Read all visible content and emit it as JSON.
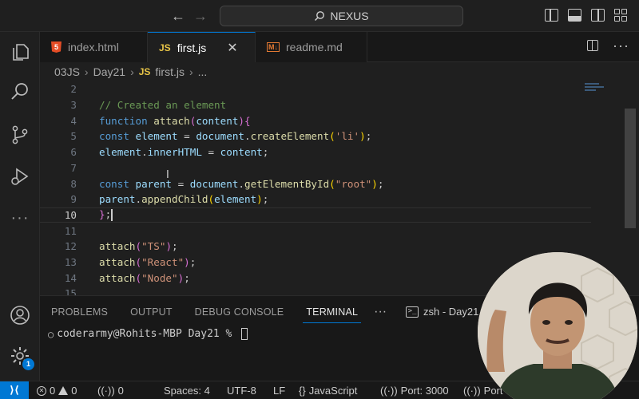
{
  "titlebar": {
    "back_arrow": "←",
    "forward_arrow": "→",
    "search_text": "NEXUS"
  },
  "tabs": [
    {
      "label": "index.html",
      "icon": "html-file-icon",
      "active": false
    },
    {
      "label": "first.js",
      "icon": "js-file-icon",
      "active": true
    },
    {
      "label": "readme.md",
      "icon": "markdown-file-icon",
      "active": false
    }
  ],
  "tab_icons": {
    "html": "5",
    "js": "JS",
    "md": "M↓"
  },
  "tab_close": "✕",
  "tab_more": "···",
  "breadcrumb": {
    "folder1": "03JS",
    "folder2": "Day21",
    "file_icon": "JS",
    "file": "first.js",
    "tail": "...",
    "sep": "›"
  },
  "editor": {
    "lines": [
      {
        "num": "2"
      },
      {
        "num": "3",
        "tokens": [
          [
            "comment",
            "// Created an element"
          ]
        ]
      },
      {
        "num": "4",
        "tokens": [
          [
            "kw",
            "function "
          ],
          [
            "fn",
            "attach"
          ],
          [
            "br1",
            "("
          ],
          [
            "var",
            "content"
          ],
          [
            "br1",
            ")"
          ],
          [
            "br1",
            "{"
          ]
        ]
      },
      {
        "num": "5",
        "tokens": [
          [
            "kw",
            "const "
          ],
          [
            "var",
            "element"
          ],
          [
            "punc",
            " = "
          ],
          [
            "var",
            "document"
          ],
          [
            "punc",
            "."
          ],
          [
            "fn",
            "createElement"
          ],
          [
            "br2",
            "("
          ],
          [
            "str",
            "'li'"
          ],
          [
            "br2",
            ")"
          ],
          [
            "punc",
            ";"
          ]
        ]
      },
      {
        "num": "6",
        "tokens": [
          [
            "var",
            "element"
          ],
          [
            "punc",
            "."
          ],
          [
            "var",
            "innerHTML"
          ],
          [
            "punc",
            " = "
          ],
          [
            "var",
            "content"
          ],
          [
            "punc",
            ";"
          ]
        ]
      },
      {
        "num": "7"
      },
      {
        "num": "8",
        "tokens": [
          [
            "kw",
            "const "
          ],
          [
            "var",
            "parent"
          ],
          [
            "punc",
            " = "
          ],
          [
            "var",
            "document"
          ],
          [
            "punc",
            "."
          ],
          [
            "fn",
            "getElementById"
          ],
          [
            "br2",
            "("
          ],
          [
            "str",
            "\"root\""
          ],
          [
            "br2",
            ")"
          ],
          [
            "punc",
            ";"
          ]
        ]
      },
      {
        "num": "9",
        "tokens": [
          [
            "var",
            "parent"
          ],
          [
            "punc",
            "."
          ],
          [
            "fn",
            "appendChild"
          ],
          [
            "br2",
            "("
          ],
          [
            "var",
            "element"
          ],
          [
            "br2",
            ")"
          ],
          [
            "punc",
            ";"
          ]
        ]
      },
      {
        "num": "10",
        "current": true,
        "tokens": [
          [
            "br1",
            "}"
          ],
          [
            "punc",
            ";"
          ]
        ]
      },
      {
        "num": "11"
      },
      {
        "num": "12",
        "tokens": [
          [
            "fn",
            "attach"
          ],
          [
            "br1",
            "("
          ],
          [
            "str",
            "\"TS\""
          ],
          [
            "br1",
            ")"
          ],
          [
            "punc",
            ";"
          ]
        ]
      },
      {
        "num": "13",
        "tokens": [
          [
            "fn",
            "attach"
          ],
          [
            "br1",
            "("
          ],
          [
            "str",
            "\"React\""
          ],
          [
            "br1",
            ")"
          ],
          [
            "punc",
            ";"
          ]
        ]
      },
      {
        "num": "14",
        "tokens": [
          [
            "fn",
            "attach"
          ],
          [
            "br1",
            "("
          ],
          [
            "str",
            "\"Node\""
          ],
          [
            "br1",
            ")"
          ],
          [
            "punc",
            ";"
          ]
        ]
      },
      {
        "num": "15"
      }
    ]
  },
  "panel": {
    "tabs": [
      "PROBLEMS",
      "OUTPUT",
      "DEBUG CONSOLE",
      "TERMINAL"
    ],
    "active_tab": "TERMINAL",
    "more": "···",
    "session": "zsh - Day21",
    "prompt_dot": "○",
    "prompt": "coderarmy@Rohits-MBP Day21 % "
  },
  "statusbar": {
    "remote": "⟩⟨",
    "errors": "0",
    "warnings": "0",
    "ports_count": "0",
    "spaces": "Spaces: 4",
    "encoding": "UTF-8",
    "eol": "LF",
    "language": "JavaScript",
    "port": "Port: 3000",
    "live": "Port"
  },
  "colors": {
    "accent": "#0078d4",
    "comment": "#6a9955",
    "keyword": "#569cd6",
    "function": "#dcdcaa",
    "variable": "#9cdcfe",
    "string": "#ce9178"
  }
}
